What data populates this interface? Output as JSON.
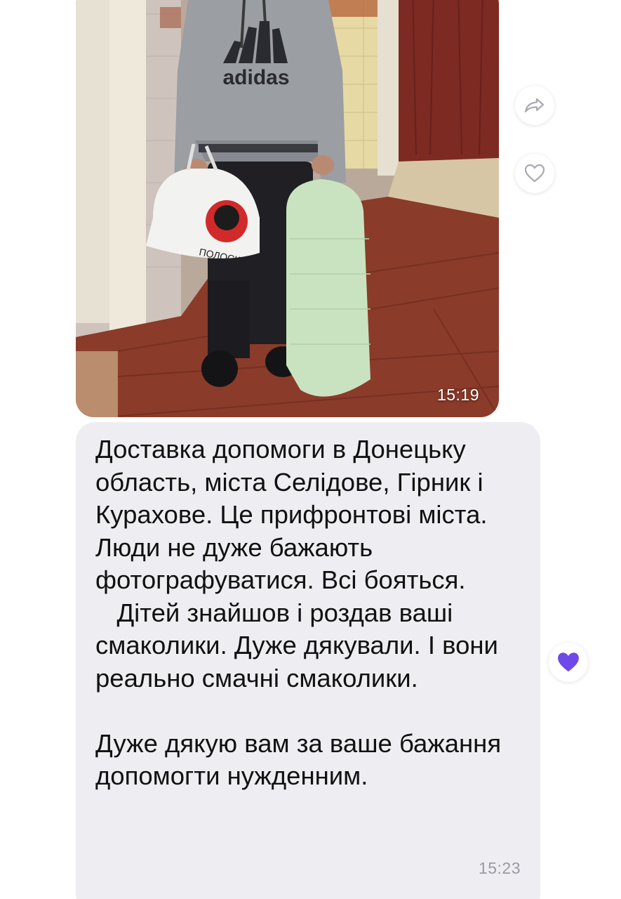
{
  "photo_message": {
    "time": "15:19",
    "image_alt": "Person in grey adidas hoodie holding a white plastic bag and a large green sack",
    "hoodie_brand": "adidas",
    "bag_brand": "ПОЛОСКУН"
  },
  "side_actions": {
    "share_icon": "share-arrow-icon",
    "like_icon": "heart-outline-icon",
    "reaction_icon": "heart-filled-icon"
  },
  "text_message": {
    "paragraph1": "Доставка допомоги в Донецьку область, міста Селідове, Гірник і Курахове. Це прифронтові міста. Люди не дуже бажають фотографуватися. Всі бояться.\n   Дітей знайшов і роздав ваші смаколики. Дуже дякували. І вони реально смачні смаколики.\n\nДуже дякую вам за ваше бажання допомогти нужденним.",
    "time": "15:23"
  },
  "colors": {
    "bubble_bg": "#eeeef2",
    "reaction_purple": "#6e48e8",
    "icon_grey": "#a9a9b4"
  }
}
